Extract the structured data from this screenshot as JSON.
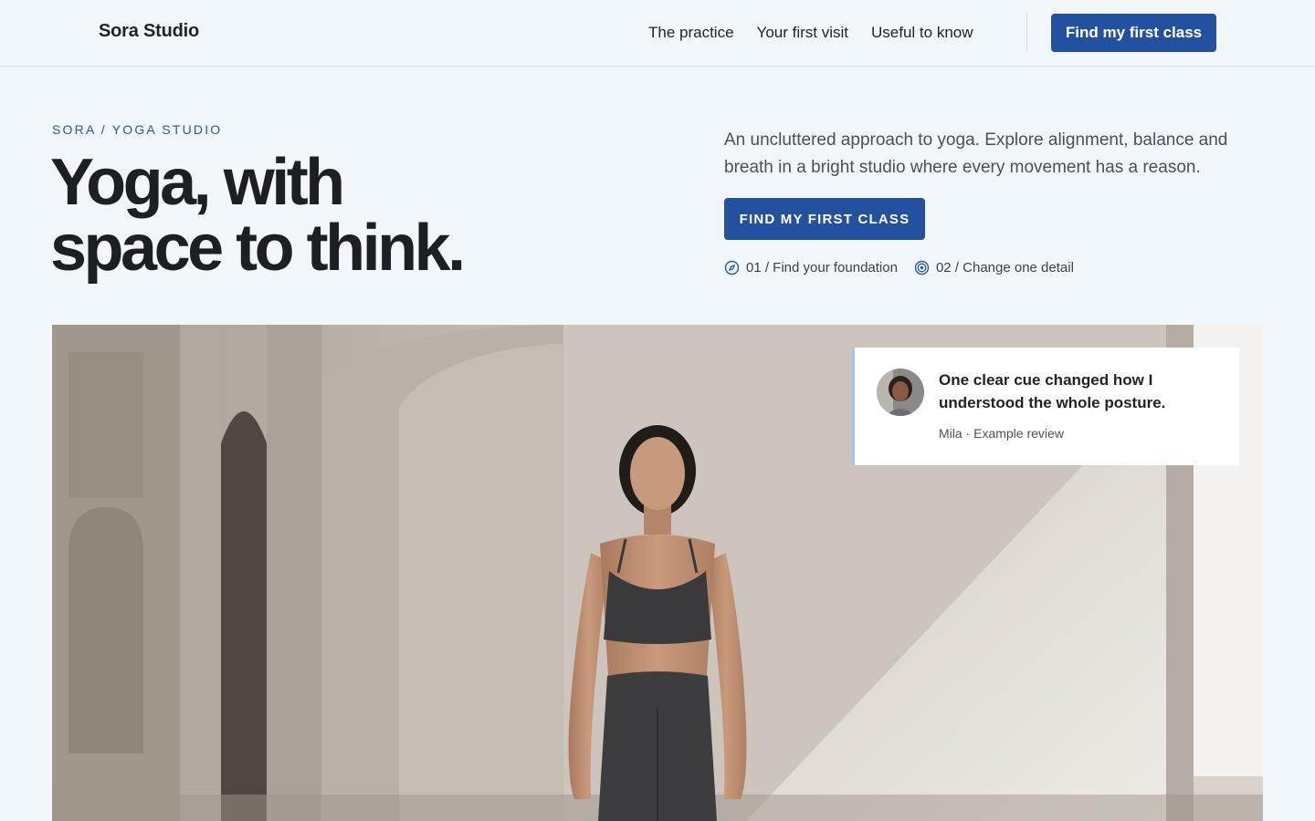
{
  "header": {
    "brand": "Sora Studio",
    "nav": [
      "The practice",
      "Your first visit",
      "Useful to know"
    ],
    "cta_label": "Find my first class"
  },
  "hero": {
    "eyebrow": "SORA / YOGA STUDIO",
    "headline_line1": "Yoga, with",
    "headline_line2": "space to think.",
    "lead": "An uncluttered approach to yoga. Explore alignment, balance and breath in a bright studio where every movement has a reason.",
    "cta_label": "FIND MY FIRST CLASS",
    "steps": [
      {
        "label": "01 / Find your foundation",
        "icon": "compass-icon"
      },
      {
        "label": "02 / Change one detail",
        "icon": "target-icon"
      }
    ]
  },
  "review": {
    "quote": "One clear cue changed how I understood the whole posture.",
    "author": "Mila · Example review"
  },
  "image": {
    "subject": "yoga-practitioner-photo"
  },
  "colors": {
    "accent": "#2450a0",
    "background": "#f1f6fb",
    "text": "#1f2328"
  }
}
